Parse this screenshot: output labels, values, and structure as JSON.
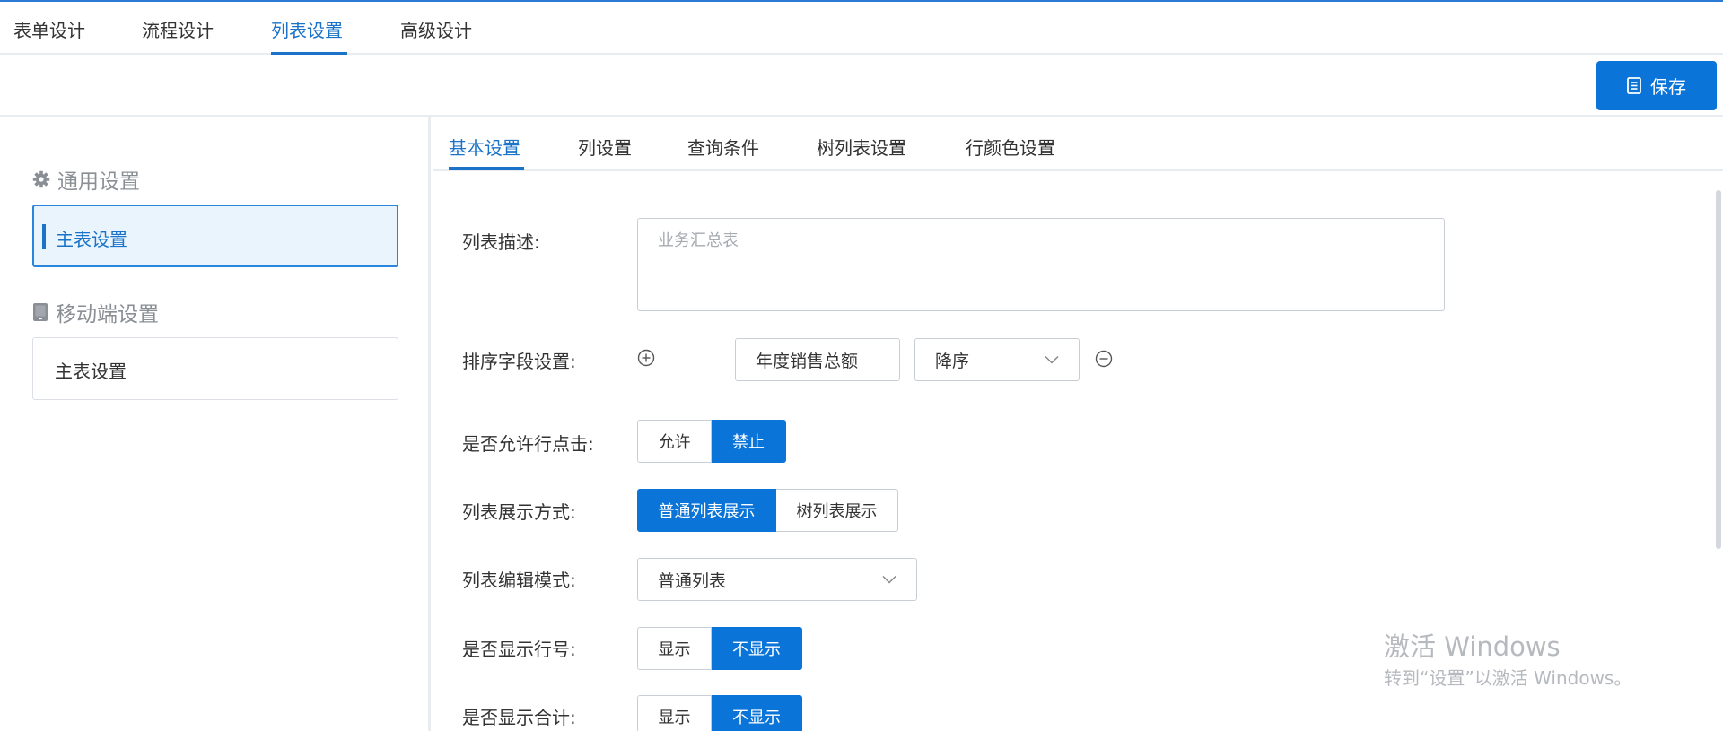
{
  "top_tabs": {
    "items": [
      {
        "label": "表单设计"
      },
      {
        "label": "流程设计"
      },
      {
        "label": "列表设置"
      },
      {
        "label": "高级设计"
      }
    ],
    "active": "列表设置"
  },
  "toolbar": {
    "save_label": "保存",
    "save_icon": "document-icon",
    "accent_color": "#0a74d8"
  },
  "left_panel": {
    "sections": [
      {
        "title": "通用设置",
        "icon": "gear-icon",
        "items": [
          {
            "label": "主表设置",
            "active": true
          }
        ]
      },
      {
        "title": "移动端设置",
        "icon": "mobile-icon",
        "items": [
          {
            "label": "主表设置",
            "active": false
          }
        ]
      }
    ]
  },
  "sub_tabs": {
    "items": [
      {
        "label": "基本设置"
      },
      {
        "label": "列设置"
      },
      {
        "label": "查询条件"
      },
      {
        "label": "树列表设置"
      },
      {
        "label": "行颜色设置"
      }
    ],
    "active": "基本设置"
  },
  "form": {
    "description": {
      "label": "列表描述:",
      "value": "业务汇总表"
    },
    "sort": {
      "label": "排序字段设置:",
      "field": "年度销售总额",
      "order": "降序",
      "add_icon": "plus-circle-icon",
      "remove_icon": "minus-circle-icon"
    },
    "row_click": {
      "label": "是否允许行点击:",
      "options": [
        "允许",
        "禁止"
      ],
      "selected": "禁止"
    },
    "display_mode": {
      "label": "列表展示方式:",
      "options": [
        "普通列表展示",
        "树列表展示"
      ],
      "selected": "普通列表展示"
    },
    "edit_mode": {
      "label": "列表编辑模式:",
      "value": "普通列表"
    },
    "row_number": {
      "label": "是否显示行号:",
      "options": [
        "显示",
        "不显示"
      ],
      "selected": "不显示"
    },
    "show_total": {
      "label": "是否显示合计:",
      "options": [
        "显示",
        "不显示"
      ],
      "selected": "不显示"
    }
  },
  "watermark": {
    "title": "激活 Windows",
    "subtitle": "转到“设置”以激活 Windows。"
  }
}
